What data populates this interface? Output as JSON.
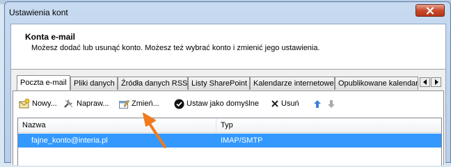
{
  "window": {
    "title": "Ustawienia kont"
  },
  "header": {
    "title": "Konta e-mail",
    "description": "Możesz dodać lub usunąć konto. Możesz też wybrać konto i zmienić jego ustawienia."
  },
  "tabs": [
    {
      "label": "Poczta e-mail",
      "active": true
    },
    {
      "label": "Pliki danych"
    },
    {
      "label": "Źródła danych RSS"
    },
    {
      "label": "Listy SharePoint"
    },
    {
      "label": "Kalendarze internetowe"
    },
    {
      "label": "Opublikowane kalendarze"
    }
  ],
  "toolbar": {
    "new_label": "Nowy...",
    "repair_label": "Napraw...",
    "change_label": "Zmień...",
    "default_label": "Ustaw jako domyślne",
    "remove_label": "Usuń"
  },
  "accounts": {
    "columns": [
      "Nazwa",
      "Typ"
    ],
    "rows": [
      {
        "name": "fajne_konto@interia.pl",
        "type": "IMAP/SMTP",
        "selected": true
      }
    ]
  },
  "colors": {
    "selection": "#3399ff",
    "arrow": "#f07b1e"
  }
}
